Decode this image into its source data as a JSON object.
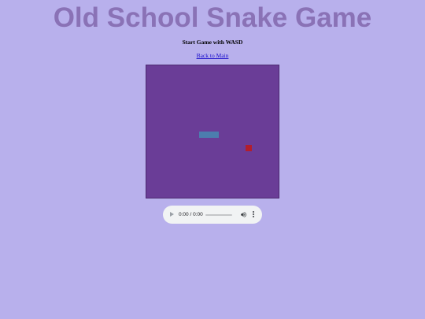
{
  "page": {
    "title": "Old School Snake Game",
    "instructions": "Start Game with WASD",
    "back_link": "Back to Main"
  },
  "game": {
    "board_color": "#6a3d97",
    "snake_color": "#4c7dae",
    "food_color": "#b21e2d",
    "snake": [
      {
        "col": 8,
        "row": 10
      },
      {
        "col": 9,
        "row": 10
      },
      {
        "col": 10,
        "row": 10
      }
    ],
    "food": {
      "col": 15,
      "row": 12
    },
    "grid_cols": 20,
    "grid_rows": 20
  },
  "audio": {
    "time": "0:00 / 0:00",
    "play_icon": "play-icon",
    "volume_icon": "volume-icon",
    "more_icon": "more-vert-icon"
  }
}
